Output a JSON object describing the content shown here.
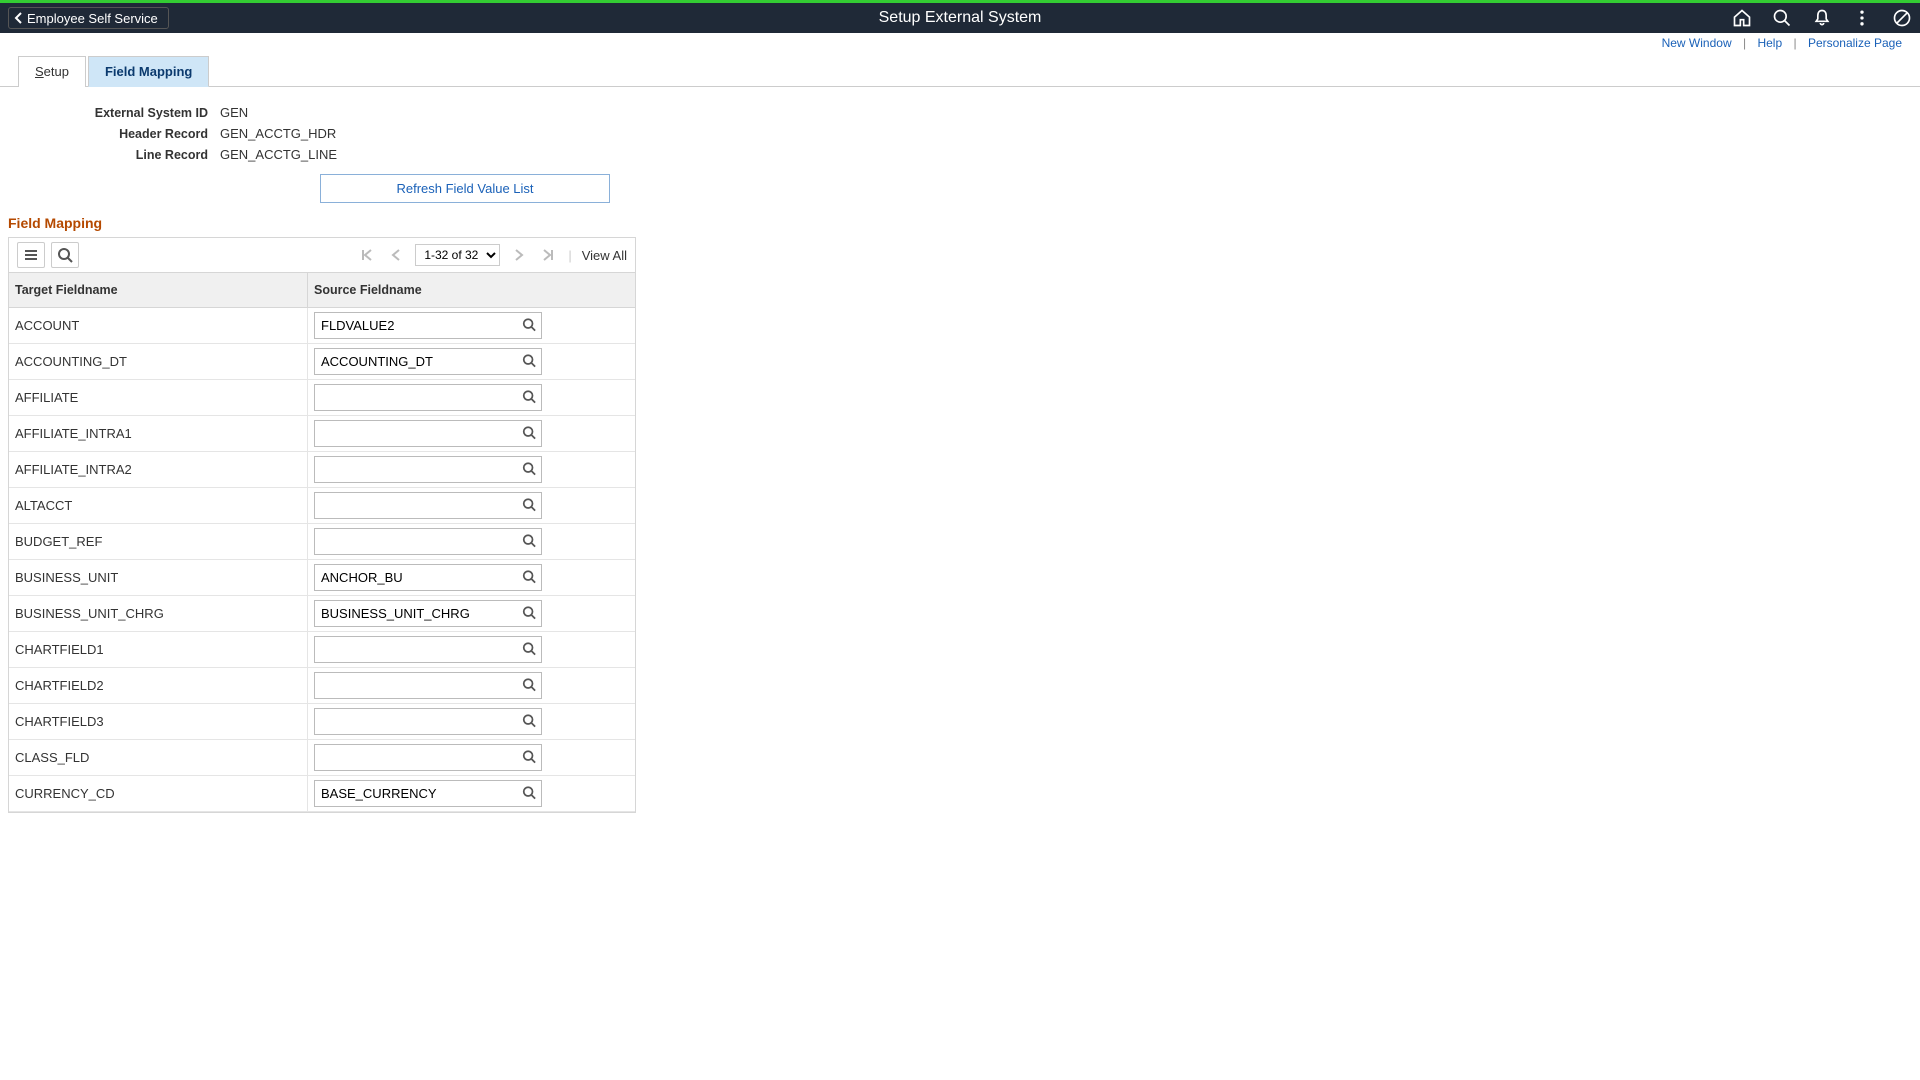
{
  "header": {
    "back_label": "Employee Self Service",
    "page_title": "Setup External System"
  },
  "sub_links": {
    "new_window": "New Window",
    "help": "Help",
    "personalize": "Personalize Page"
  },
  "tabs": {
    "setup": "Setup",
    "setup_underline": "S",
    "setup_rest": "etup",
    "field_mapping": "Field Mapping"
  },
  "form": {
    "labels": {
      "external_system_id": "External System ID",
      "header_record": "Header Record",
      "line_record": "Line Record"
    },
    "values": {
      "external_system_id": "GEN",
      "header_record": "GEN_ACCTG_HDR",
      "line_record": "GEN_ACCTG_LINE"
    },
    "refresh_button": "Refresh Field Value List"
  },
  "section": {
    "title": "Field Mapping"
  },
  "grid": {
    "pager": "1-32 of 32",
    "view_all": "View All",
    "columns": {
      "target": "Target Fieldname",
      "source": "Source Fieldname"
    },
    "rows": [
      {
        "target": "ACCOUNT",
        "source": "FLDVALUE2"
      },
      {
        "target": "ACCOUNTING_DT",
        "source": "ACCOUNTING_DT"
      },
      {
        "target": "AFFILIATE",
        "source": ""
      },
      {
        "target": "AFFILIATE_INTRA1",
        "source": ""
      },
      {
        "target": "AFFILIATE_INTRA2",
        "source": ""
      },
      {
        "target": "ALTACCT",
        "source": ""
      },
      {
        "target": "BUDGET_REF",
        "source": ""
      },
      {
        "target": "BUSINESS_UNIT",
        "source": "ANCHOR_BU"
      },
      {
        "target": "BUSINESS_UNIT_CHRG",
        "source": "BUSINESS_UNIT_CHRG"
      },
      {
        "target": "CHARTFIELD1",
        "source": ""
      },
      {
        "target": "CHARTFIELD2",
        "source": ""
      },
      {
        "target": "CHARTFIELD3",
        "source": ""
      },
      {
        "target": "CLASS_FLD",
        "source": ""
      },
      {
        "target": "CURRENCY_CD",
        "source": "BASE_CURRENCY"
      }
    ]
  }
}
